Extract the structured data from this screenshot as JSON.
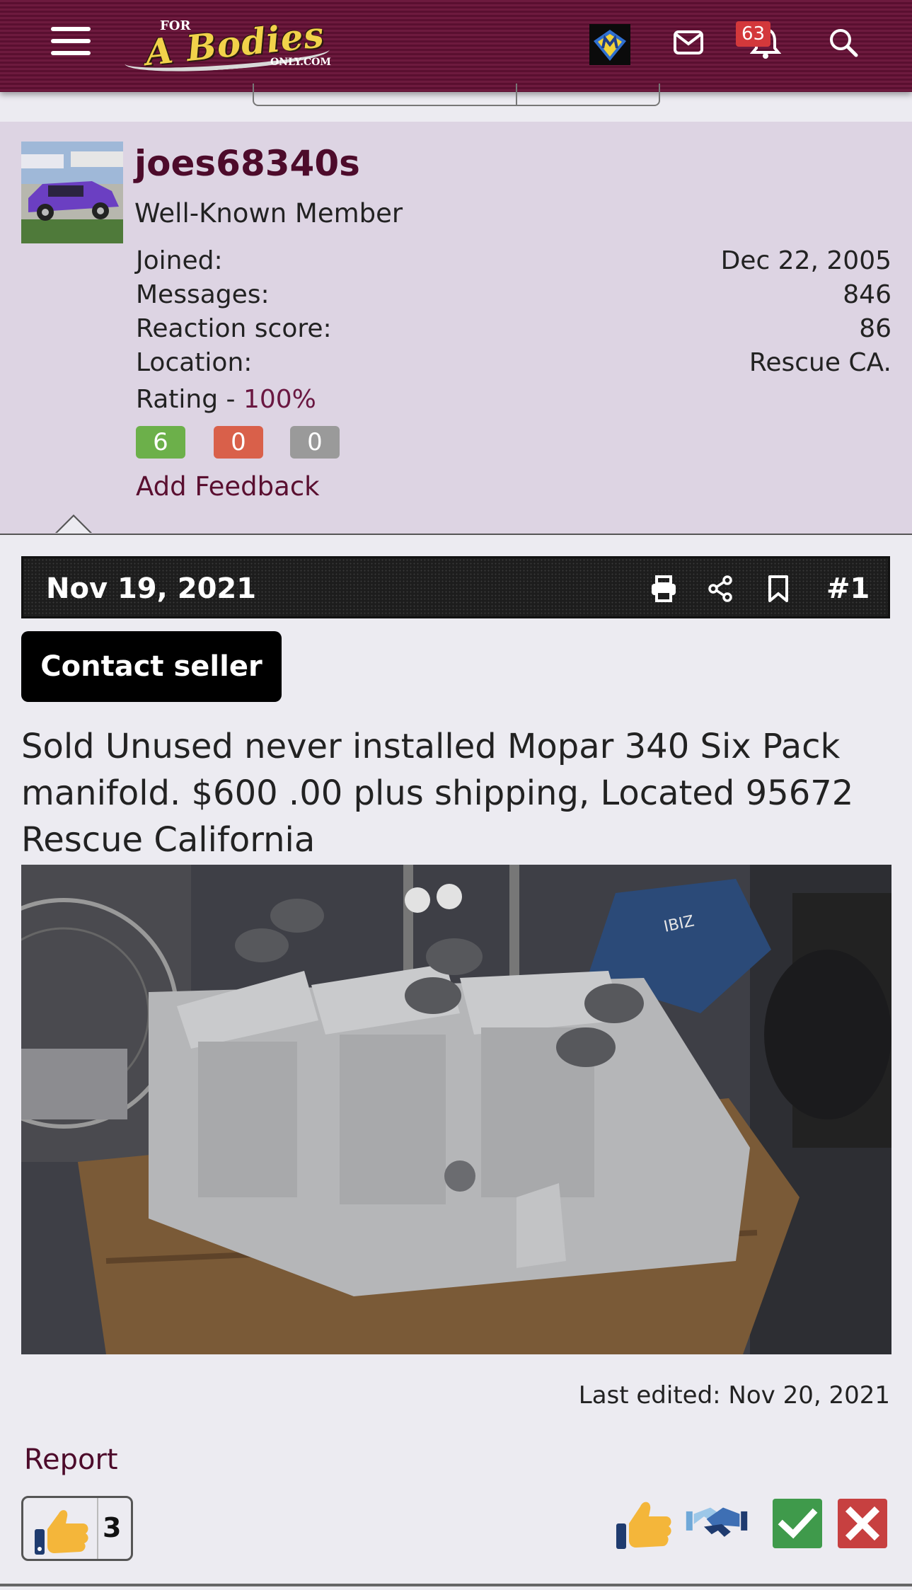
{
  "header": {
    "logo_for": "FOR",
    "logo_main": "A Bodies",
    "logo_only": "ONLY.COM",
    "notification_count": "63"
  },
  "user": {
    "name": "joes68340s",
    "title": "Well-Known Member",
    "stats": [
      {
        "label": "Joined:",
        "value": "Dec 22, 2005"
      },
      {
        "label": "Messages:",
        "value": "846"
      },
      {
        "label": "Reaction score:",
        "value": "86"
      },
      {
        "label": "Location:",
        "value": "Rescue CA."
      }
    ],
    "rating_label": "Rating - ",
    "rating_value": "100%",
    "feedback": {
      "positive": "6",
      "negative": "0",
      "neutral": "0"
    },
    "add_feedback": "Add Feedback"
  },
  "post": {
    "date": "Nov 19, 2021",
    "number": "#1",
    "contact_label": "Contact seller",
    "text": "Sold Unused never installed Mopar 340 Six Pack manifold. $600 .00 plus shipping, Located 95672 Rescue California",
    "last_edited": "Last edited: Nov 20, 2021",
    "report_label": "Report",
    "reaction_count": "3"
  },
  "colors": {
    "header_bg": "#5a0f30",
    "user_bg": "#ddd4e3",
    "page_bg": "#ecebf1",
    "accent": "#4d0b2b",
    "feedback_positive": "#6cb04a",
    "feedback_negative": "#d9604a",
    "feedback_neutral": "#9a9a9a"
  },
  "icons": [
    "menu-icon",
    "site-logo",
    "user-avatar-icon",
    "mail-icon",
    "bell-icon",
    "search-icon",
    "print-icon",
    "share-icon",
    "bookmark-icon",
    "like-icon",
    "agree-icon",
    "deal-icon",
    "check-icon",
    "close-icon"
  ]
}
